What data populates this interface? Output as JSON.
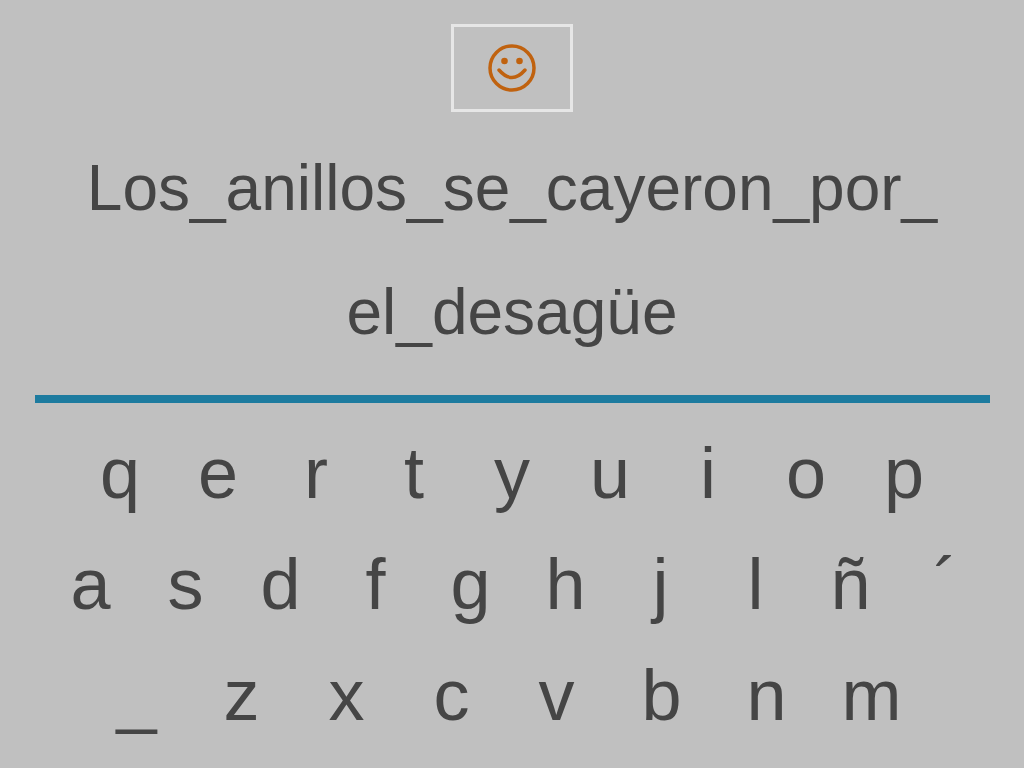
{
  "sentence_lines": [
    "Los_anillos_se_cayeron_por_",
    "el_desagüe"
  ],
  "keyboard_rows": [
    [
      "q",
      "e",
      "r",
      "t",
      "y",
      "u",
      "i",
      "o",
      "p"
    ],
    [
      "a",
      "s",
      "d",
      "f",
      "g",
      "h",
      "j",
      "l",
      "ñ",
      "´"
    ],
    [
      "_",
      "z",
      "x",
      "c",
      "v",
      "b",
      "n",
      "m"
    ]
  ]
}
